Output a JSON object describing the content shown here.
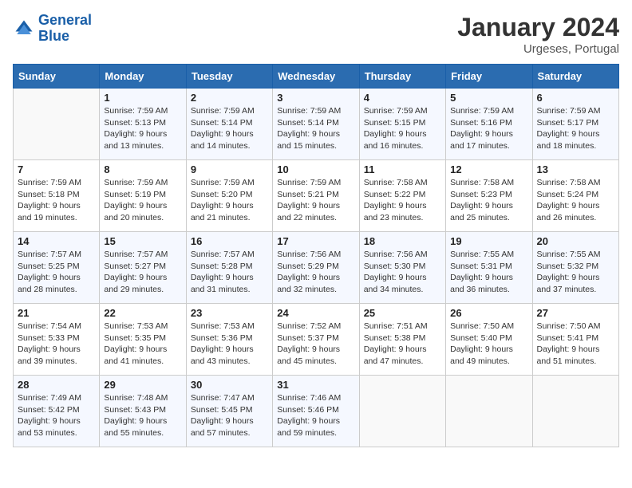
{
  "header": {
    "logo_line1": "General",
    "logo_line2": "Blue",
    "month_year": "January 2024",
    "location": "Urgeses, Portugal"
  },
  "days_of_week": [
    "Sunday",
    "Monday",
    "Tuesday",
    "Wednesday",
    "Thursday",
    "Friday",
    "Saturday"
  ],
  "weeks": [
    [
      {
        "day": "",
        "sunrise": "",
        "sunset": "",
        "daylight": ""
      },
      {
        "day": "1",
        "sunrise": "Sunrise: 7:59 AM",
        "sunset": "Sunset: 5:13 PM",
        "daylight": "Daylight: 9 hours and 13 minutes."
      },
      {
        "day": "2",
        "sunrise": "Sunrise: 7:59 AM",
        "sunset": "Sunset: 5:14 PM",
        "daylight": "Daylight: 9 hours and 14 minutes."
      },
      {
        "day": "3",
        "sunrise": "Sunrise: 7:59 AM",
        "sunset": "Sunset: 5:14 PM",
        "daylight": "Daylight: 9 hours and 15 minutes."
      },
      {
        "day": "4",
        "sunrise": "Sunrise: 7:59 AM",
        "sunset": "Sunset: 5:15 PM",
        "daylight": "Daylight: 9 hours and 16 minutes."
      },
      {
        "day": "5",
        "sunrise": "Sunrise: 7:59 AM",
        "sunset": "Sunset: 5:16 PM",
        "daylight": "Daylight: 9 hours and 17 minutes."
      },
      {
        "day": "6",
        "sunrise": "Sunrise: 7:59 AM",
        "sunset": "Sunset: 5:17 PM",
        "daylight": "Daylight: 9 hours and 18 minutes."
      }
    ],
    [
      {
        "day": "7",
        "sunrise": "Sunrise: 7:59 AM",
        "sunset": "Sunset: 5:18 PM",
        "daylight": "Daylight: 9 hours and 19 minutes."
      },
      {
        "day": "8",
        "sunrise": "Sunrise: 7:59 AM",
        "sunset": "Sunset: 5:19 PM",
        "daylight": "Daylight: 9 hours and 20 minutes."
      },
      {
        "day": "9",
        "sunrise": "Sunrise: 7:59 AM",
        "sunset": "Sunset: 5:20 PM",
        "daylight": "Daylight: 9 hours and 21 minutes."
      },
      {
        "day": "10",
        "sunrise": "Sunrise: 7:59 AM",
        "sunset": "Sunset: 5:21 PM",
        "daylight": "Daylight: 9 hours and 22 minutes."
      },
      {
        "day": "11",
        "sunrise": "Sunrise: 7:58 AM",
        "sunset": "Sunset: 5:22 PM",
        "daylight": "Daylight: 9 hours and 23 minutes."
      },
      {
        "day": "12",
        "sunrise": "Sunrise: 7:58 AM",
        "sunset": "Sunset: 5:23 PM",
        "daylight": "Daylight: 9 hours and 25 minutes."
      },
      {
        "day": "13",
        "sunrise": "Sunrise: 7:58 AM",
        "sunset": "Sunset: 5:24 PM",
        "daylight": "Daylight: 9 hours and 26 minutes."
      }
    ],
    [
      {
        "day": "14",
        "sunrise": "Sunrise: 7:57 AM",
        "sunset": "Sunset: 5:25 PM",
        "daylight": "Daylight: 9 hours and 28 minutes."
      },
      {
        "day": "15",
        "sunrise": "Sunrise: 7:57 AM",
        "sunset": "Sunset: 5:27 PM",
        "daylight": "Daylight: 9 hours and 29 minutes."
      },
      {
        "day": "16",
        "sunrise": "Sunrise: 7:57 AM",
        "sunset": "Sunset: 5:28 PM",
        "daylight": "Daylight: 9 hours and 31 minutes."
      },
      {
        "day": "17",
        "sunrise": "Sunrise: 7:56 AM",
        "sunset": "Sunset: 5:29 PM",
        "daylight": "Daylight: 9 hours and 32 minutes."
      },
      {
        "day": "18",
        "sunrise": "Sunrise: 7:56 AM",
        "sunset": "Sunset: 5:30 PM",
        "daylight": "Daylight: 9 hours and 34 minutes."
      },
      {
        "day": "19",
        "sunrise": "Sunrise: 7:55 AM",
        "sunset": "Sunset: 5:31 PM",
        "daylight": "Daylight: 9 hours and 36 minutes."
      },
      {
        "day": "20",
        "sunrise": "Sunrise: 7:55 AM",
        "sunset": "Sunset: 5:32 PM",
        "daylight": "Daylight: 9 hours and 37 minutes."
      }
    ],
    [
      {
        "day": "21",
        "sunrise": "Sunrise: 7:54 AM",
        "sunset": "Sunset: 5:33 PM",
        "daylight": "Daylight: 9 hours and 39 minutes."
      },
      {
        "day": "22",
        "sunrise": "Sunrise: 7:53 AM",
        "sunset": "Sunset: 5:35 PM",
        "daylight": "Daylight: 9 hours and 41 minutes."
      },
      {
        "day": "23",
        "sunrise": "Sunrise: 7:53 AM",
        "sunset": "Sunset: 5:36 PM",
        "daylight": "Daylight: 9 hours and 43 minutes."
      },
      {
        "day": "24",
        "sunrise": "Sunrise: 7:52 AM",
        "sunset": "Sunset: 5:37 PM",
        "daylight": "Daylight: 9 hours and 45 minutes."
      },
      {
        "day": "25",
        "sunrise": "Sunrise: 7:51 AM",
        "sunset": "Sunset: 5:38 PM",
        "daylight": "Daylight: 9 hours and 47 minutes."
      },
      {
        "day": "26",
        "sunrise": "Sunrise: 7:50 AM",
        "sunset": "Sunset: 5:40 PM",
        "daylight": "Daylight: 9 hours and 49 minutes."
      },
      {
        "day": "27",
        "sunrise": "Sunrise: 7:50 AM",
        "sunset": "Sunset: 5:41 PM",
        "daylight": "Daylight: 9 hours and 51 minutes."
      }
    ],
    [
      {
        "day": "28",
        "sunrise": "Sunrise: 7:49 AM",
        "sunset": "Sunset: 5:42 PM",
        "daylight": "Daylight: 9 hours and 53 minutes."
      },
      {
        "day": "29",
        "sunrise": "Sunrise: 7:48 AM",
        "sunset": "Sunset: 5:43 PM",
        "daylight": "Daylight: 9 hours and 55 minutes."
      },
      {
        "day": "30",
        "sunrise": "Sunrise: 7:47 AM",
        "sunset": "Sunset: 5:45 PM",
        "daylight": "Daylight: 9 hours and 57 minutes."
      },
      {
        "day": "31",
        "sunrise": "Sunrise: 7:46 AM",
        "sunset": "Sunset: 5:46 PM",
        "daylight": "Daylight: 9 hours and 59 minutes."
      },
      {
        "day": "",
        "sunrise": "",
        "sunset": "",
        "daylight": ""
      },
      {
        "day": "",
        "sunrise": "",
        "sunset": "",
        "daylight": ""
      },
      {
        "day": "",
        "sunrise": "",
        "sunset": "",
        "daylight": ""
      }
    ]
  ]
}
